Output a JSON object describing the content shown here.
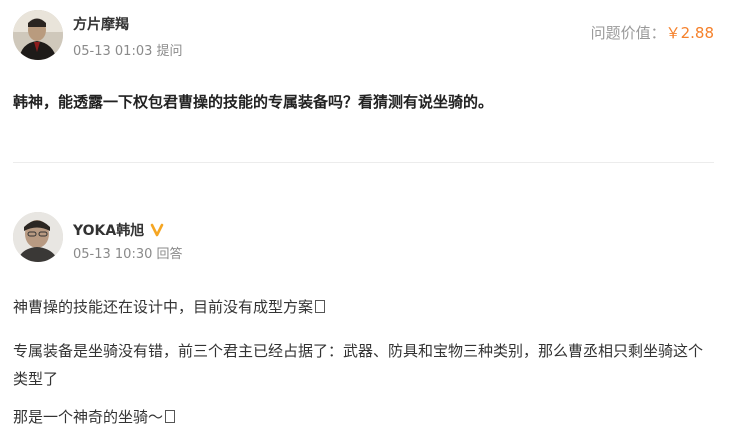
{
  "question": {
    "asker": {
      "name": "方片摩羯",
      "time": "05-13 01:03",
      "action": "提问"
    },
    "price_label": "问题价值：",
    "price_value": "￥2.88",
    "text": "韩神，能透露一下权包君曹操的技能的专属装备吗？看猜测有说坐骑的。"
  },
  "answer": {
    "author": {
      "name": "YOKA韩旭",
      "verified": true,
      "time": "05-13 10:30",
      "action": "回答"
    },
    "paragraphs": [
      "神曹操的技能还在设计中，目前没有成型方案",
      "专属装备是坐骑没有错，前三个君主已经占据了：武器、防具和宝物三种类别，那么曹丞相只剩坐骑这个类型了",
      "那是一个神奇的坐骑～"
    ]
  },
  "colors": {
    "accent_price": "#f5812b",
    "verified_badge": "#f5a623",
    "meta_text": "#8a8a8a"
  }
}
